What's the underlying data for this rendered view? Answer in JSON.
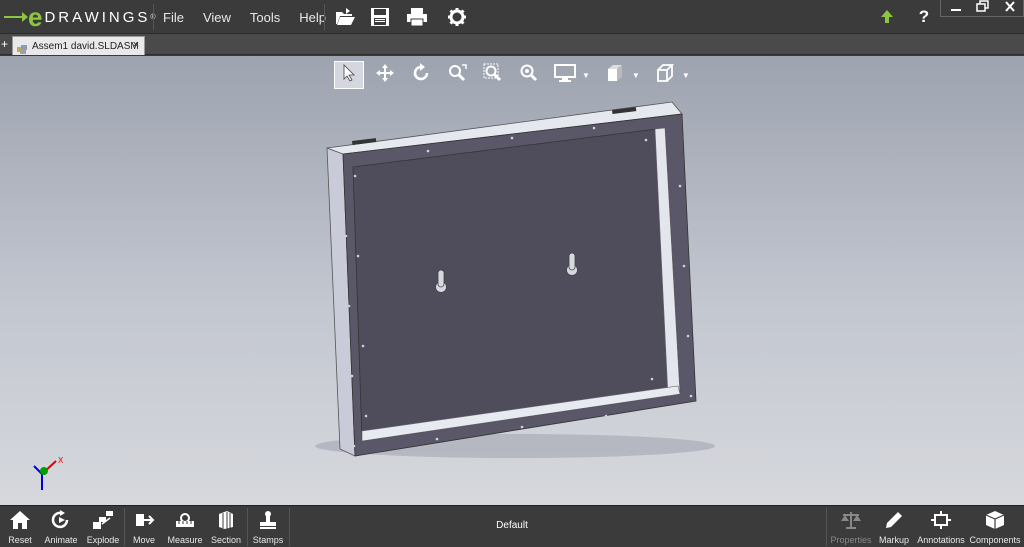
{
  "app": {
    "logo_letter": "e",
    "logo_word": "DRAWINGS",
    "logo_mark": "®",
    "accent_color": "#8cc63f"
  },
  "menu": {
    "items": [
      {
        "label": "File"
      },
      {
        "label": "View"
      },
      {
        "label": "Tools"
      },
      {
        "label": "Help"
      }
    ]
  },
  "toolbar": {
    "icons": [
      "open-folder-icon",
      "save-icon",
      "print-icon",
      "gear-icon"
    ]
  },
  "window": {
    "help_symbol": "?",
    "icons": [
      "upload-arrow-icon",
      "help-icon",
      "minimize-icon",
      "restore-icon",
      "close-icon"
    ]
  },
  "tabs": {
    "add_symbol": "+",
    "items": [
      {
        "label": "Assem1 david.SLDASM",
        "close_symbol": "×"
      }
    ]
  },
  "view_toolbar": {
    "buttons": [
      {
        "icon": "select-arrow-icon",
        "active": true
      },
      {
        "icon": "pan-icon"
      },
      {
        "icon": "rotate-icon"
      },
      {
        "icon": "zoom-fit-icon"
      },
      {
        "icon": "zoom-area-icon"
      },
      {
        "icon": "zoom-icon"
      },
      {
        "icon": "display-monitor-icon",
        "dropdown": true
      },
      {
        "icon": "view-orientation-icon",
        "dropdown": true
      },
      {
        "icon": "cube-icon",
        "dropdown": true
      }
    ]
  },
  "triad": {
    "x_label": "X",
    "colors": {
      "x": "#e00000",
      "y": "#00a000",
      "z": "#0000e0"
    }
  },
  "bottom_bar": {
    "left_buttons": [
      {
        "label": "Reset",
        "icon": "home-icon"
      },
      {
        "label": "Animate",
        "icon": "animate-icon"
      },
      {
        "label": "Explode",
        "icon": "explode-icon"
      },
      {
        "label": "Move",
        "icon": "move-icon"
      },
      {
        "label": "Measure",
        "icon": "measure-icon"
      },
      {
        "label": "Section",
        "icon": "section-icon"
      },
      {
        "label": "Stamps",
        "icon": "stamp-icon"
      }
    ],
    "configuration": "Default",
    "right_buttons": [
      {
        "label": "Properties",
        "icon": "scale-icon",
        "disabled": true
      },
      {
        "label": "Markup",
        "icon": "pencil-icon"
      },
      {
        "label": "Annotations",
        "icon": "annotation-icon"
      },
      {
        "label": "Components",
        "icon": "components-icon"
      }
    ]
  }
}
